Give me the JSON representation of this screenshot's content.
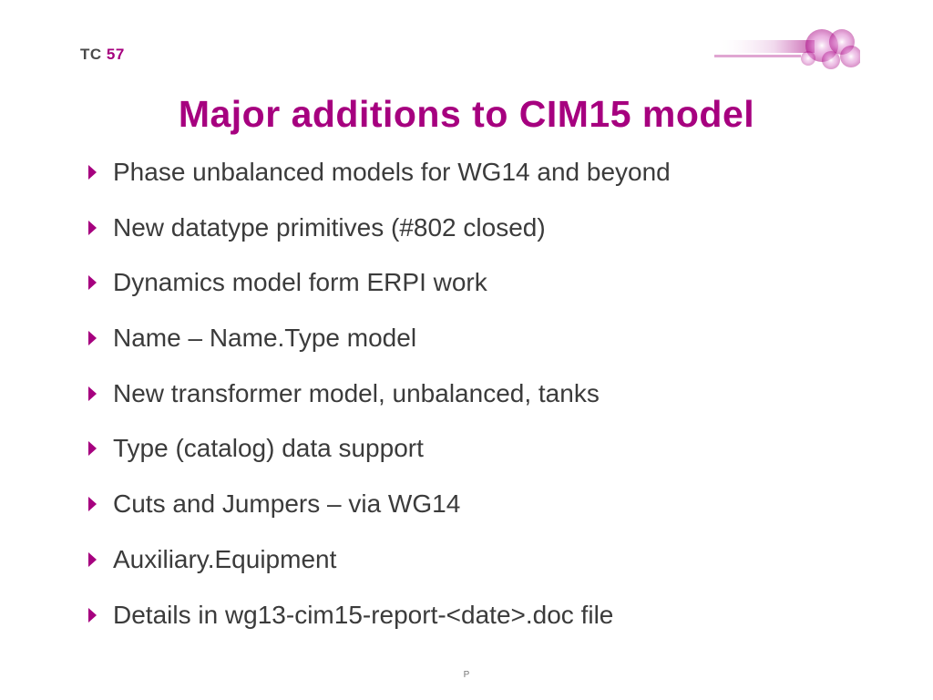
{
  "header": {
    "prefix": "TC",
    "number": "57"
  },
  "title": "Major additions to CIM15 model",
  "bullets": [
    "Phase unbalanced models for WG14 and beyond",
    "New datatype primitives (#802 closed)",
    "Dynamics model form ERPI work",
    "Name – Name.Type model",
    "New transformer model, unbalanced, tanks",
    "Type (catalog) data support",
    "Cuts and Jumpers – via WG14",
    "Auxiliary.Equipment",
    "Details in wg13-cim15-report-<date>.doc file"
  ],
  "footer": "P",
  "colors": {
    "accent": "#a6007f",
    "text": "#3b3b3b"
  }
}
